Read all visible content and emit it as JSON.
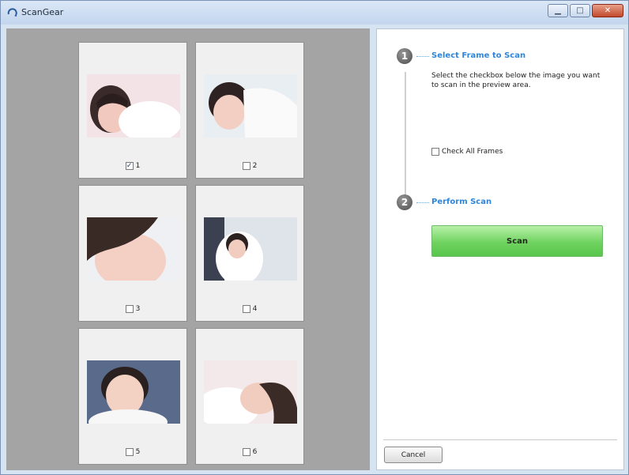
{
  "window": {
    "title": "ScanGear"
  },
  "frames": [
    {
      "label": "1",
      "checked": true
    },
    {
      "label": "2",
      "checked": false
    },
    {
      "label": "3",
      "checked": false
    },
    {
      "label": "4",
      "checked": false
    },
    {
      "label": "5",
      "checked": false
    },
    {
      "label": "6",
      "checked": false
    }
  ],
  "panel": {
    "step1": {
      "number": "1",
      "title": "Select Frame to Scan",
      "description": "Select the checkbox below the image you want to scan in the preview area."
    },
    "check_all_label": "Check All Frames",
    "step2": {
      "number": "2",
      "title": "Perform Scan"
    },
    "scan_button_label": "Scan",
    "cancel_button_label": "Cancel"
  },
  "colors": {
    "accent": "#2f86d8",
    "scan_button": "#6fd35f",
    "preview_bg": "#a4a4a4"
  }
}
